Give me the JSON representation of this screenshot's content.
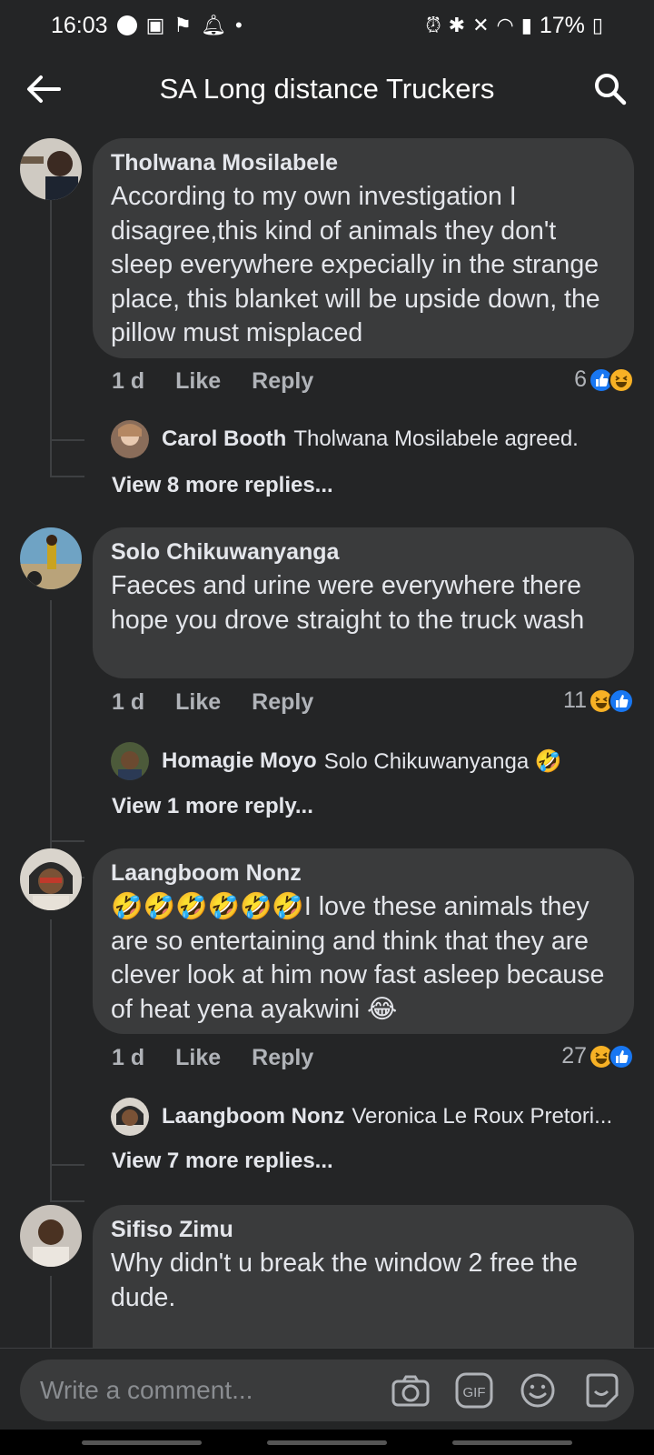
{
  "status_bar": {
    "time": "16:03",
    "battery": "17%"
  },
  "header": {
    "title": "SA Long distance Truckers"
  },
  "actions": {
    "like": "Like",
    "reply": "Reply"
  },
  "comments": [
    {
      "author": "Tholwana Mosilabele",
      "text": "According to my own investigation I disagree,this kind of animals they don't sleep everywhere expecially in the strange place, this blanket will be upside down, the pillow must misplaced",
      "age": "1 d",
      "reactions_count": "6",
      "reply_preview": {
        "author": "Carol Booth",
        "text": "Tholwana Mosilabele agreed."
      },
      "view_more": "View 8 more replies..."
    },
    {
      "author": "Solo Chikuwanyanga",
      "text": "Faeces and urine were everywhere there hope you drove straight to the truck wash",
      "age": "1 d",
      "reactions_count": "11",
      "reply_preview": {
        "author": "Homagie Moyo",
        "text": "Solo Chikuwanyanga 🤣"
      },
      "view_more": "View 1 more reply..."
    },
    {
      "author": "Laangboom Nonz",
      "text": "🤣🤣🤣🤣🤣🤣I love these animals they are so entertaining and think that they are clever look at him now fast asleep because of heat yena ayakwini 😂",
      "age": "1 d",
      "reactions_count": "27",
      "reply_preview": {
        "author": "Laangboom Nonz",
        "text": "Veronica Le Roux Pretori..."
      },
      "view_more": "View 7 more replies..."
    },
    {
      "author": "Sifiso Zimu",
      "text": "Why didn't u break the window 2 free the dude."
    }
  ],
  "composer": {
    "placeholder": "Write a comment..."
  },
  "colors": {
    "background": "#242526",
    "bubble": "#3a3b3c",
    "like_blue": "#1877f2",
    "haha_yellow": "#f7b125"
  }
}
